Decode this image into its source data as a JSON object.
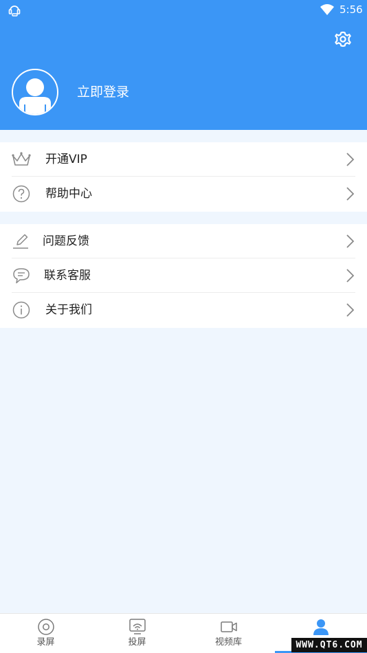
{
  "status_bar": {
    "time": "5:56"
  },
  "profile": {
    "login_label": "立即登录"
  },
  "menu_group_1": [
    {
      "label": "开通VIP",
      "icon": "crown-icon"
    },
    {
      "label": "帮助中心",
      "icon": "help-icon"
    }
  ],
  "menu_group_2": [
    {
      "label": "问题反馈",
      "icon": "edit-icon"
    },
    {
      "label": "联系客服",
      "icon": "chat-icon"
    },
    {
      "label": "关于我们",
      "icon": "info-icon"
    }
  ],
  "tabs": [
    {
      "label": "录屏",
      "icon": "record-icon"
    },
    {
      "label": "投屏",
      "icon": "cast-icon"
    },
    {
      "label": "视频库",
      "icon": "video-icon"
    },
    {
      "label": "",
      "icon": "user-icon",
      "active": true
    }
  ],
  "watermark": "WWW.QT6.COM",
  "colors": {
    "primary": "#3b96f6",
    "background": "#eff6fe",
    "icon_gray": "#8a8a8a"
  }
}
